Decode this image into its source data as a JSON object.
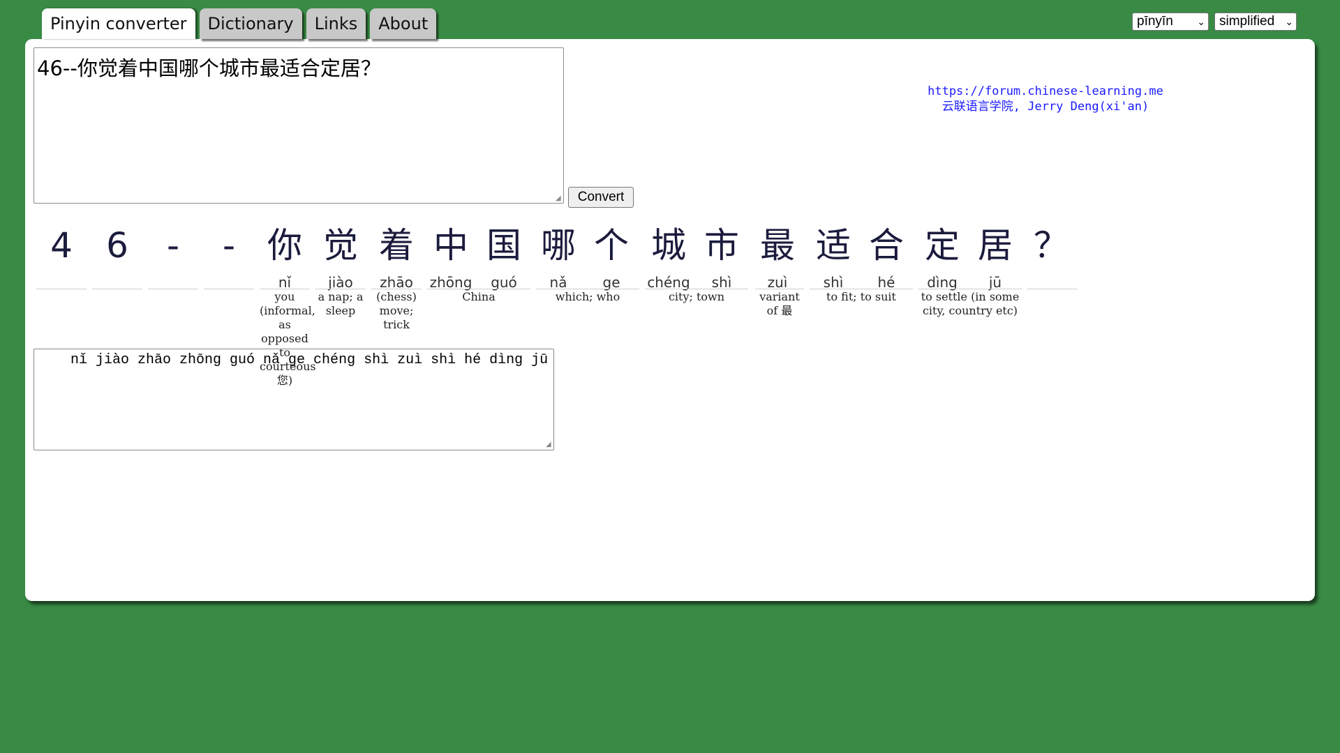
{
  "tabs": [
    {
      "label": "Pinyin converter",
      "active": true
    },
    {
      "label": "Dictionary",
      "active": false
    },
    {
      "label": "Links",
      "active": false
    },
    {
      "label": "About",
      "active": false
    }
  ],
  "selects": {
    "mode": {
      "selected": "pīnyīn"
    },
    "script": {
      "selected": "simplified"
    }
  },
  "input": {
    "value": "46--你觉着中国哪个城市最适合定居？"
  },
  "convert_button": {
    "label": "Convert"
  },
  "credits": {
    "url": "https://forum.chinese-learning.me",
    "author": "云联语言学院, Jerry Deng(xi'an)"
  },
  "characters": [
    {
      "hanzi": "4",
      "pinyin": ""
    },
    {
      "hanzi": "6",
      "pinyin": ""
    },
    {
      "hanzi": "-",
      "pinyin": ""
    },
    {
      "hanzi": "-",
      "pinyin": ""
    },
    {
      "hanzi": "你",
      "pinyin": "nǐ"
    },
    {
      "hanzi": "觉",
      "pinyin": "jiào"
    },
    {
      "hanzi": "着",
      "pinyin": "zhāo"
    },
    {
      "hanzi": "中",
      "pinyin": "zhōng"
    },
    {
      "hanzi": "国",
      "pinyin": "guó"
    },
    {
      "hanzi": "哪",
      "pinyin": "nǎ"
    },
    {
      "hanzi": "个",
      "pinyin": "ge"
    },
    {
      "hanzi": "城",
      "pinyin": "chéng"
    },
    {
      "hanzi": "市",
      "pinyin": "shì"
    },
    {
      "hanzi": "最",
      "pinyin": "zuì"
    },
    {
      "hanzi": "适",
      "pinyin": "shì"
    },
    {
      "hanzi": "合",
      "pinyin": "hé"
    },
    {
      "hanzi": "定",
      "pinyin": "dìng"
    },
    {
      "hanzi": "居",
      "pinyin": "jū"
    },
    {
      "hanzi": "？",
      "pinyin": ""
    }
  ],
  "glosses": [
    {
      "text": "you (informal, as opposed to courteous 您)"
    },
    {
      "text": "a nap; a sleep"
    },
    {
      "text": "(chess) move; trick"
    },
    {
      "text": "China"
    },
    {
      "text": "which; who"
    },
    {
      "text": "city; town"
    },
    {
      "text": "variant of 最"
    },
    {
      "text": "to fit; to suit"
    },
    {
      "text": "to settle (in some city, country etc)"
    }
  ],
  "output": {
    "value": "nǐ jiào zhāo zhōng guó nǎ ge chéng shì zuì shì hé dìng jū"
  },
  "colors": {
    "background": "#388a44",
    "panel": "#ffffff",
    "link": "#1a1aff",
    "hanzi": "#1b1b3d"
  }
}
